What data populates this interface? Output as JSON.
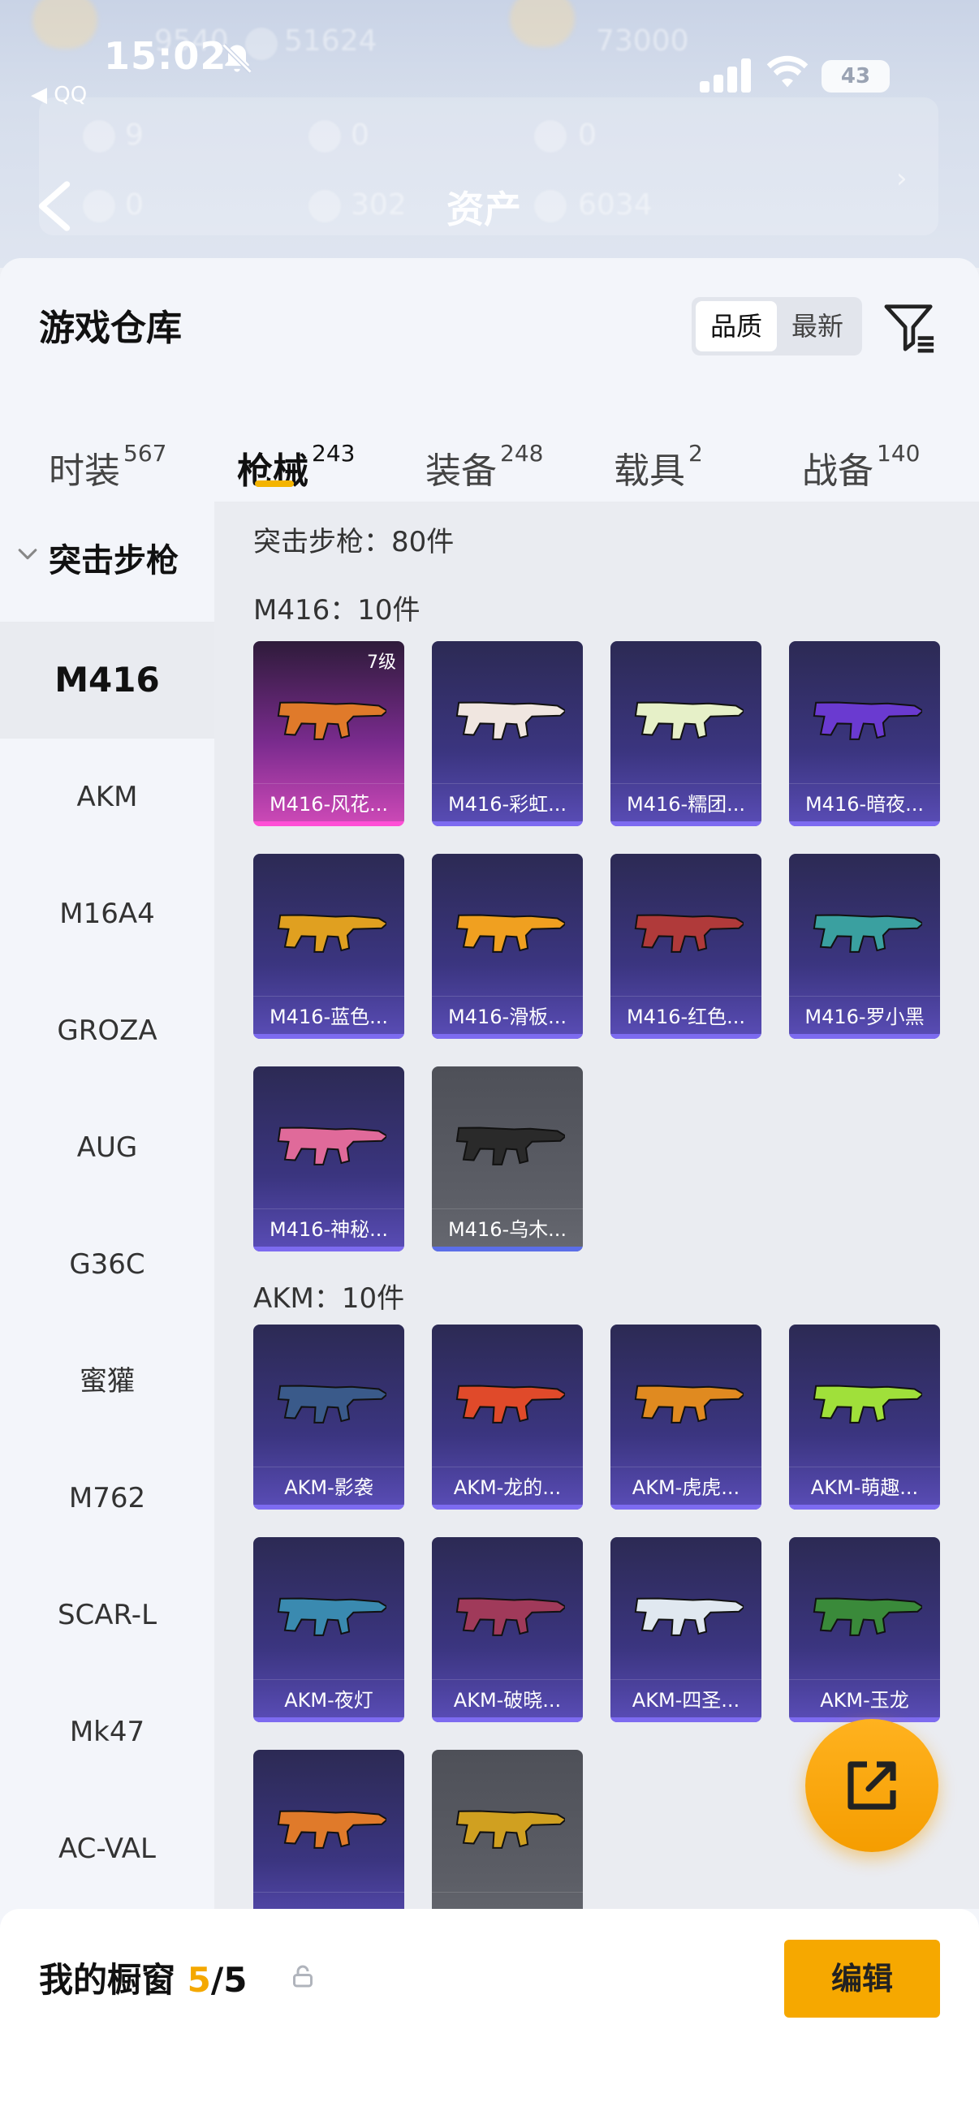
{
  "status_bar": {
    "time": "15:02",
    "back_app": "◀ QQ",
    "battery": "43"
  },
  "nav": {
    "title": "资产"
  },
  "background_stats": [
    "9540",
    "51624",
    "73000",
    "9",
    "0",
    "0",
    "0",
    "302",
    "6034"
  ],
  "sheet": {
    "title": "游戏仓库",
    "sort_options": [
      "品质",
      "最新"
    ],
    "selected_sort": "品质"
  },
  "tabs": [
    {
      "label": "时装",
      "count": "567"
    },
    {
      "label": "枪械",
      "count": "243"
    },
    {
      "label": "装备",
      "count": "248"
    },
    {
      "label": "载具",
      "count": "2"
    },
    {
      "label": "战备",
      "count": "140"
    }
  ],
  "active_tab": "枪械",
  "sidebar": {
    "category": "突击步枪",
    "items": [
      "M416",
      "AKM",
      "M16A4",
      "GROZA",
      "AUG",
      "G36C",
      "蜜獾",
      "M762",
      "SCAR-L",
      "Mk47",
      "AC-VAL"
    ],
    "selected": "M416"
  },
  "content": {
    "total": "突击步枪：80件",
    "sections": [
      {
        "title": "M416：10件",
        "items": [
          {
            "name": "M416-风花...",
            "quality": "pink",
            "level": "7级",
            "color": "#e07a2a"
          },
          {
            "name": "M416-彩虹...",
            "quality": "purple",
            "color": "#f0e6e0"
          },
          {
            "name": "M416-糯团...",
            "quality": "purple",
            "color": "#e6f0c8"
          },
          {
            "name": "M416-暗夜...",
            "quality": "purple",
            "color": "#6a3ad0"
          },
          {
            "name": "M416-蓝色...",
            "quality": "purple",
            "color": "#e0a020"
          },
          {
            "name": "M416-滑板...",
            "quality": "purple",
            "color": "#f0a020"
          },
          {
            "name": "M416-红色...",
            "quality": "purple",
            "color": "#b03a3a"
          },
          {
            "name": "M416-罗小黑",
            "quality": "purple",
            "color": "#3aa0a0"
          },
          {
            "name": "M416-神秘...",
            "quality": "purple",
            "color": "#e06a9a"
          },
          {
            "name": "M416-乌木...",
            "quality": "grey",
            "color": "#2a2a2a"
          }
        ]
      },
      {
        "title": "AKM：10件",
        "items": [
          {
            "name": "AKM-影袭",
            "quality": "purple",
            "color": "#3a5a8a"
          },
          {
            "name": "AKM-龙的...",
            "quality": "purple",
            "color": "#e04a2a"
          },
          {
            "name": "AKM-虎虎...",
            "quality": "purple",
            "color": "#e08a20"
          },
          {
            "name": "AKM-萌趣...",
            "quality": "purple",
            "color": "#a0e03a"
          },
          {
            "name": "AKM-夜灯",
            "quality": "purple",
            "color": "#3a8ab0"
          },
          {
            "name": "AKM-破晓...",
            "quality": "purple",
            "color": "#a03a5a"
          },
          {
            "name": "AKM-四圣...",
            "quality": "purple",
            "color": "#e0e8f0"
          },
          {
            "name": "AKM-玉龙",
            "quality": "purple",
            "color": "#3a8a3a"
          },
          {
            "name": "",
            "quality": "purple",
            "color": "#e07a2a"
          },
          {
            "name": "",
            "quality": "grey",
            "color": "#d0a020"
          }
        ]
      }
    ]
  },
  "bottom": {
    "title_prefix": "我的橱窗 ",
    "shown": "5",
    "separator": "/",
    "capacity": "5",
    "edit_label": "编辑"
  },
  "colors": {
    "accent": "#f6a800",
    "tab_underline": "#f4b400"
  },
  "icons": {
    "back": "chevron-left-icon",
    "filter": "filter-icon",
    "share": "share-out-icon",
    "lock": "lock-icon",
    "mute": "bell-slash-icon"
  }
}
